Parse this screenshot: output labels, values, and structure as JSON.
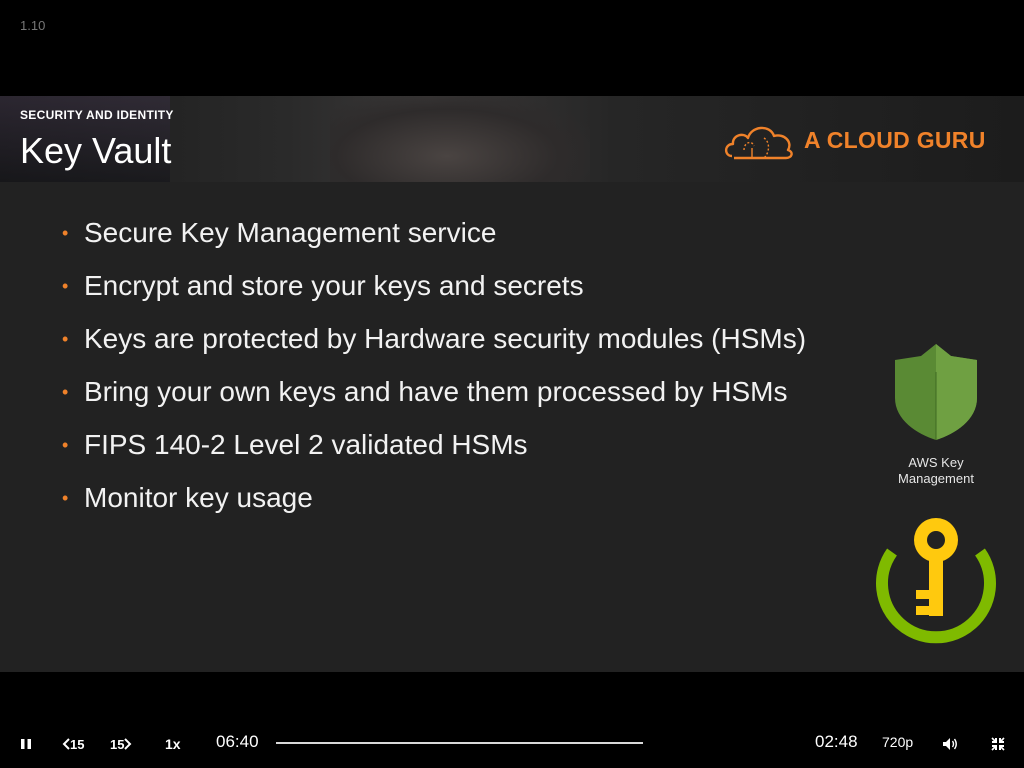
{
  "video": {
    "version": "1.10"
  },
  "slide": {
    "section_label": "SECURITY AND IDENTITY",
    "title": "Key Vault",
    "brand": "A CLOUD GURU",
    "bullets": [
      "Secure Key Management service",
      "Encrypt and store your keys and secrets",
      "Keys are protected by Hardware security modules (HSMs)",
      "Bring your own keys and have them processed by HSMs",
      "FIPS 140-2 Level 2 validated HSMs",
      "Monitor key usage"
    ],
    "bullet_marker": "•",
    "aws_label": "AWS Key Management",
    "colors": {
      "accent": "#f0822a",
      "aws_green": "#5a8a34",
      "azure_green": "#7fba00",
      "azure_yellow": "#ffc90e"
    }
  },
  "player": {
    "back_label": "15",
    "forward_label": "15",
    "speed": "1x",
    "elapsed": "06:40",
    "remaining": "02:48",
    "quality": "720p",
    "icons": [
      "pause-icon",
      "rewind-15-icon",
      "forward-15-icon",
      "volume-icon",
      "exit-fullscreen-icon"
    ]
  }
}
